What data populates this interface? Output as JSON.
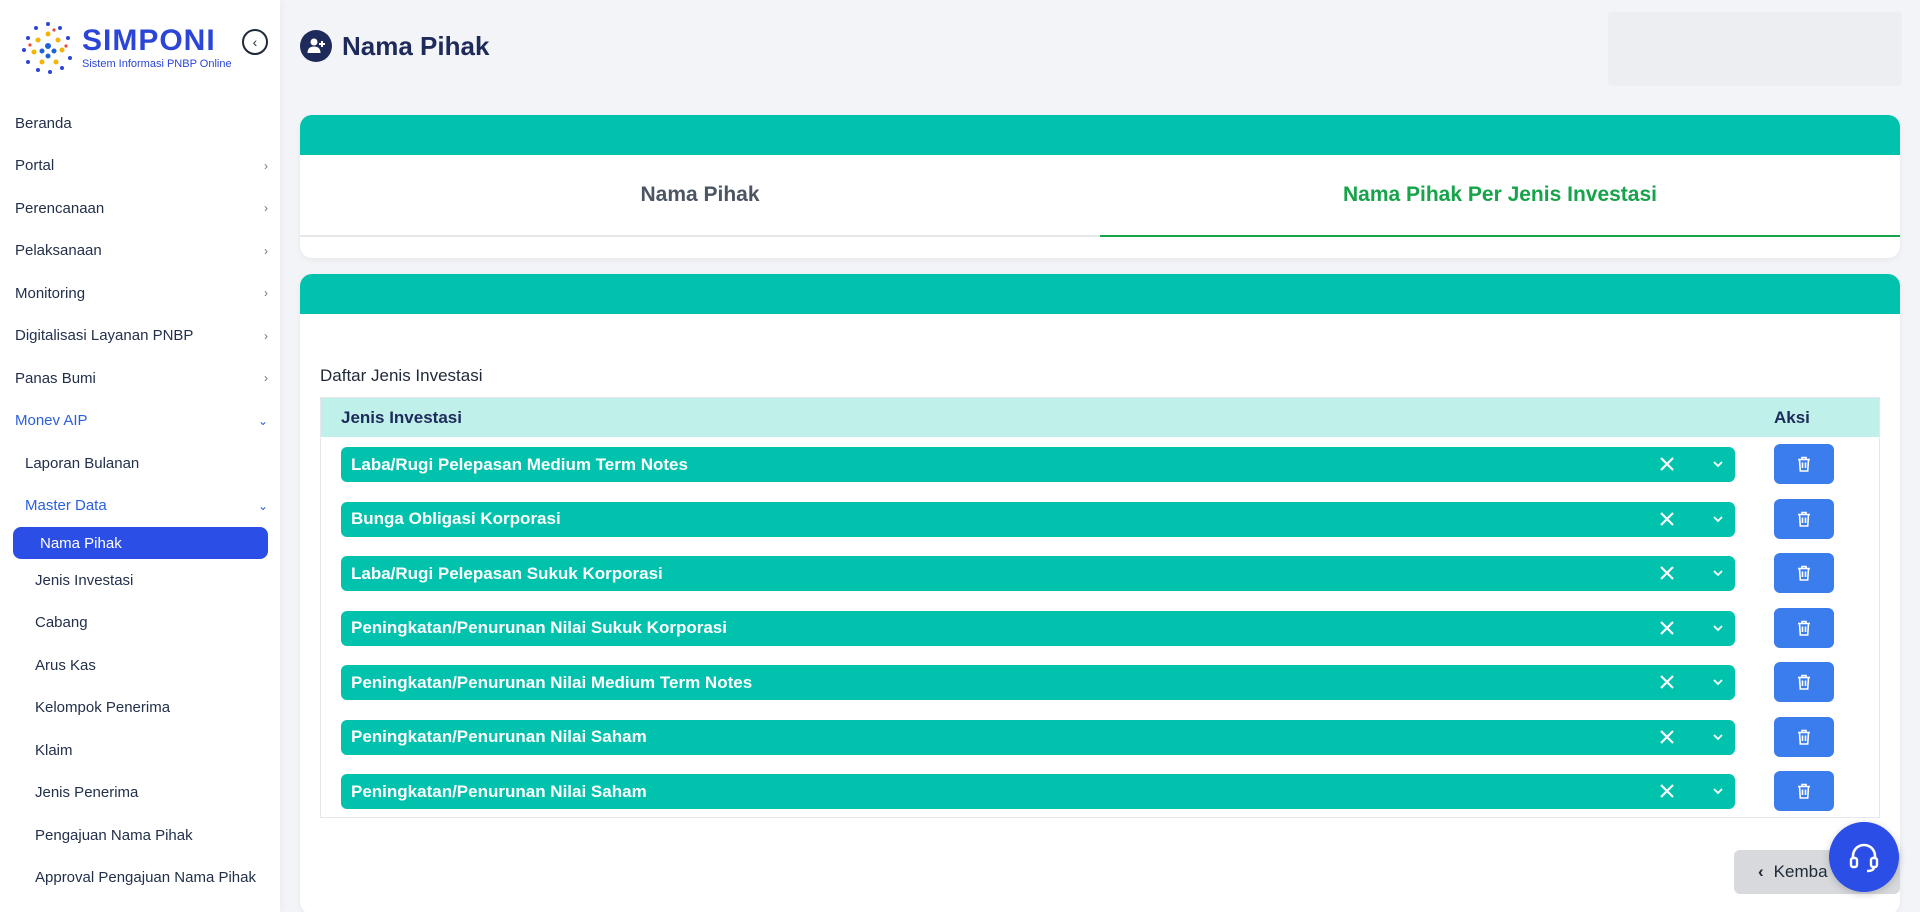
{
  "app": {
    "logo_title": "SIMPONI",
    "logo_subtitle": "Sistem Informasi PNBP Online"
  },
  "sidebar": {
    "items": [
      {
        "label": "Beranda"
      },
      {
        "label": "Portal"
      },
      {
        "label": "Perencanaan"
      },
      {
        "label": "Pelaksanaan"
      },
      {
        "label": "Monitoring"
      },
      {
        "label": "Digitalisasi Layanan PNBP"
      },
      {
        "label": "Panas Bumi"
      },
      {
        "label": "Monev AIP"
      }
    ],
    "monev": {
      "laporan": "Laporan Bulanan",
      "master": "Master Data",
      "master_items": [
        "Nama Pihak",
        "Jenis Investasi",
        "Cabang",
        "Arus Kas",
        "Kelompok Penerima",
        "Klaim",
        "Jenis Penerima",
        "Pengajuan Nama Pihak",
        "Approval Pengajuan Nama Pihak"
      ]
    }
  },
  "header": {
    "title": "Nama Pihak"
  },
  "tabs": [
    {
      "label": "Nama Pihak"
    },
    {
      "label": "Nama Pihak Per Jenis Investasi"
    }
  ],
  "main": {
    "section_label": "Daftar Jenis Investasi",
    "columns": [
      "Jenis Investasi",
      "Aksi"
    ],
    "rows": [
      "Laba/Rugi Pelepasan Medium Term Notes",
      "Bunga Obligasi Korporasi",
      "Laba/Rugi Pelepasan Sukuk Korporasi",
      "Peningkatan/Penurunan Nilai Sukuk Korporasi",
      "Peningkatan/Penurunan Nilai Medium Term Notes",
      "Peningkatan/Penurunan Nilai Saham",
      "Peningkatan/Penurunan Nilai Saham"
    ],
    "back_label": "Kemba"
  },
  "colors": {
    "accent_teal": "#00c2ad",
    "primary_blue": "#2b4ee6",
    "active_tab_green": "#16a34a"
  },
  "icons": {
    "header": "user-plus-icon",
    "collapse": "chevron-left-circle-icon",
    "row_clear": "close-icon",
    "row_dropdown": "chevron-down-icon",
    "row_delete": "trash-icon",
    "help": "headset-icon"
  }
}
